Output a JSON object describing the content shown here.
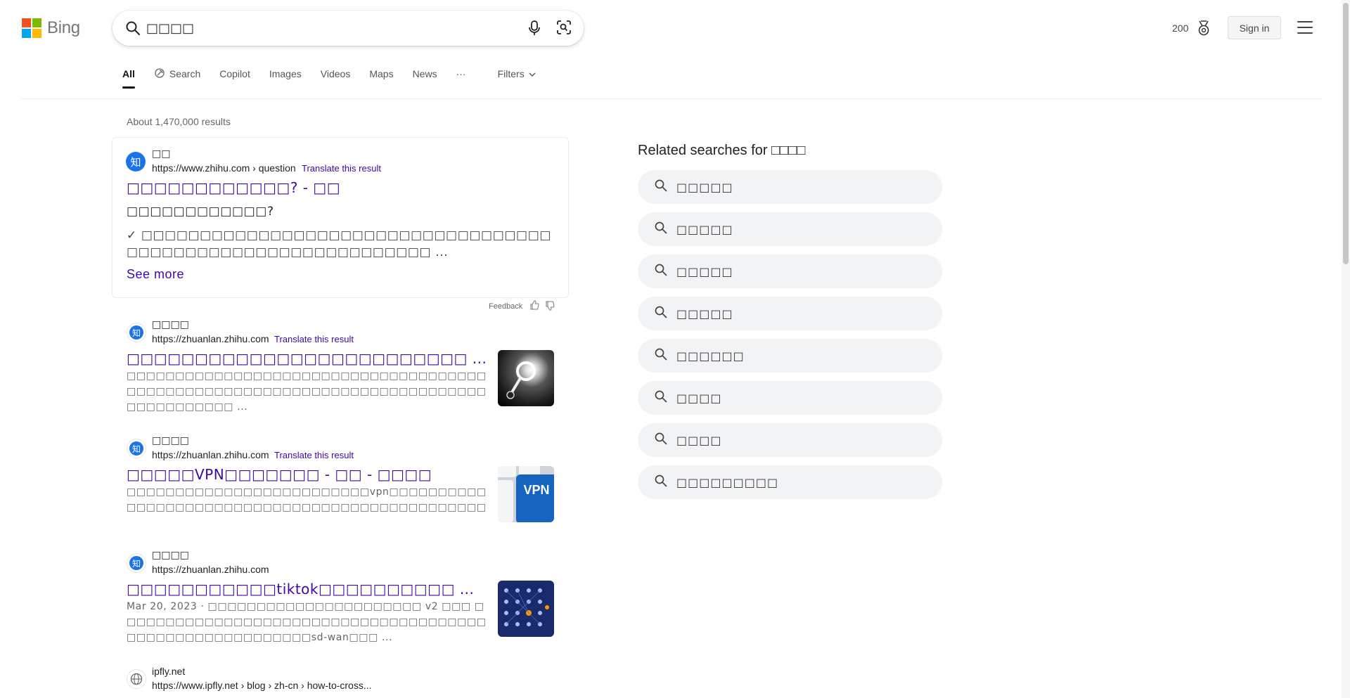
{
  "header": {
    "logo_text": "Bing",
    "search_value": "□□□□",
    "rewards_points": "200",
    "signin_label": "Sign in"
  },
  "nav": {
    "items": [
      {
        "label": "All"
      },
      {
        "label": "Search"
      },
      {
        "label": "Copilot"
      },
      {
        "label": "Images"
      },
      {
        "label": "Videos"
      },
      {
        "label": "Maps"
      },
      {
        "label": "News"
      },
      {
        "label": "···"
      },
      {
        "label": "Filters"
      }
    ]
  },
  "results_count": "About 1,470,000 results",
  "featured": {
    "site_name": "□□",
    "url": "https://www.zhihu.com › question",
    "translate": "Translate this result",
    "title": "□□□□□□□□□□□□? - □□",
    "question": "□□□□□□□□□□□□?",
    "answer": "✓ □□□□□□□□□□□□□□□□□□□□□□□□□□□□□□□□□□□□□□□□□□□□□□□□□□□□□□□□□□□□□ ...",
    "see_more": "See more",
    "feedback": "Feedback"
  },
  "results": [
    {
      "site_name": "□□□□",
      "url": "https://zhuanlan.zhihu.com",
      "translate": "Translate this result",
      "title": "□□□□□□□□□□□□□□□□□□□□□□□□□ ...",
      "snippet": "□□□□□□□□□□□□□□□□□□□□□□□□□□□□□□□□□□□□□□□□□□□□□□□□□□□□□□□□□□□□□□□□□□□□□□□□□□□□□□□□□□□□□ ..."
    },
    {
      "site_name": "□□□□",
      "url": "https://zhuanlan.zhihu.com",
      "translate": "Translate this result",
      "title": "□□□□□VPN□□□□□□□ - □□ - □□□□",
      "snippet": "□□□□□□□□□□□□□□□□□□□□□□□□□vpn□□□□□□□□□□□□□□□□□□□□□□□□□□□□□□□□□□□□□□□□□□□□□□□□□□□□□□□□□VPN□□",
      "thumb_text": "VPN"
    },
    {
      "site_name": "□□□□",
      "url": "https://zhuanlan.zhihu.com",
      "title": "□□□□□□□□□□□tiktok□□□□□□□□□□ ...",
      "snippet": "Mar 20, 2023 · □□□□□□□□□□□□□□□□□□□□□□ v2 □□□ □□□□□□□□□□□□□□□□□□□□□□□□□□□□□□□□□□□□□□□□□□□□□□□□□□□□□□□□□sd-wan□□□ ..."
    },
    {
      "site_name": "ipfly.net",
      "url": "https://www.ipfly.net › blog › zh-cn › how-to-cross..."
    }
  ],
  "related": {
    "heading": "Related searches for □□□□",
    "items": [
      {
        "label": "□□□□□"
      },
      {
        "label": "□□□□□"
      },
      {
        "label": "□□□□□"
      },
      {
        "label": "□□□□□"
      },
      {
        "label": "□□□□□□"
      },
      {
        "label": "□□□□"
      },
      {
        "label": "□□□□"
      },
      {
        "label": "□□□□□□□□□"
      }
    ]
  },
  "colors": {
    "link": "#4007a2",
    "ms_red": "#f25022",
    "ms_green": "#7fba00",
    "ms_blue": "#00a4ef",
    "ms_yellow": "#ffb900"
  }
}
